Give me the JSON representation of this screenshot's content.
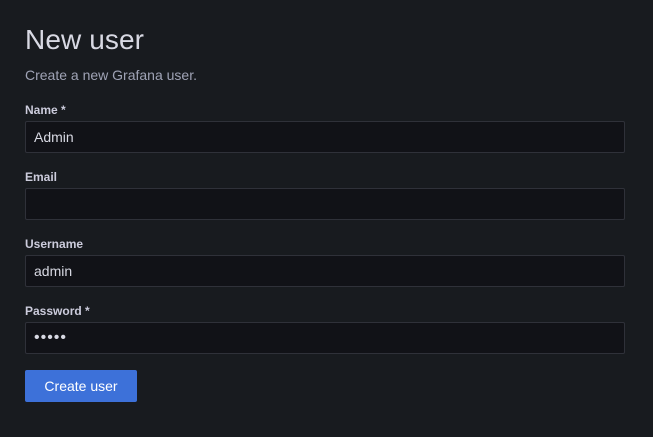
{
  "page": {
    "title": "New user",
    "subtitle": "Create a new Grafana user."
  },
  "form": {
    "name": {
      "label": "Name *",
      "value": "Admin"
    },
    "email": {
      "label": "Email",
      "value": ""
    },
    "username": {
      "label": "Username",
      "value": "admin"
    },
    "password": {
      "label": "Password *",
      "value": "admin"
    },
    "submit_label": "Create user"
  },
  "colors": {
    "background": "#181b1f",
    "input_background": "#111217",
    "input_border": "#2f3139",
    "primary_button": "#3d71d9",
    "title_text": "#d8d9e3",
    "secondary_text": "#9fa3b5"
  }
}
